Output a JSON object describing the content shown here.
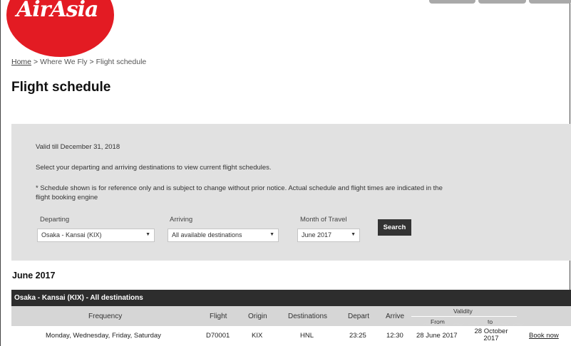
{
  "brand": {
    "logo_text": "AirAsia",
    "color": "#e31b23"
  },
  "breadcrumb": {
    "home": "Home",
    "sep1": ">",
    "where": "Where We Fly",
    "sep2": ">",
    "current": "Flight schedule"
  },
  "page_title": "Flight schedule",
  "form": {
    "valid_till": "Valid till December 31, 2018",
    "instruction": "Select your departing and arriving destinations to view current flight schedules.",
    "note": "* Schedule shown is for reference only and is subject to change without prior notice. Actual schedule and flight times are indicated in the flight booking engine",
    "departing_label": "Departing",
    "departing_value": "Osaka - Kansai (KIX)",
    "arriving_label": "Arriving",
    "arriving_value": "All available destinations",
    "month_label": "Month of Travel",
    "month_value": "June 2017",
    "search_label": "Search",
    "caret": "▼"
  },
  "schedule": {
    "month_heading": "June 2017",
    "route_title": "Osaka - Kansai (KIX) - All destinations",
    "columns": {
      "frequency": "Frequency",
      "flight": "Flight",
      "origin": "Origin",
      "destinations": "Destinations",
      "depart": "Depart",
      "arrive": "Arrive",
      "validity": "Validity",
      "from": "From",
      "to": "to"
    },
    "rows": [
      {
        "frequency": "Monday, Wednesday, Friday, Saturday",
        "flight": "D70001",
        "origin": "KIX",
        "destination": "HNL",
        "depart": "23:25",
        "arrive": "12:30",
        "from": "28 June 2017",
        "to": "28 October 2017",
        "action": "Book now"
      }
    ]
  }
}
